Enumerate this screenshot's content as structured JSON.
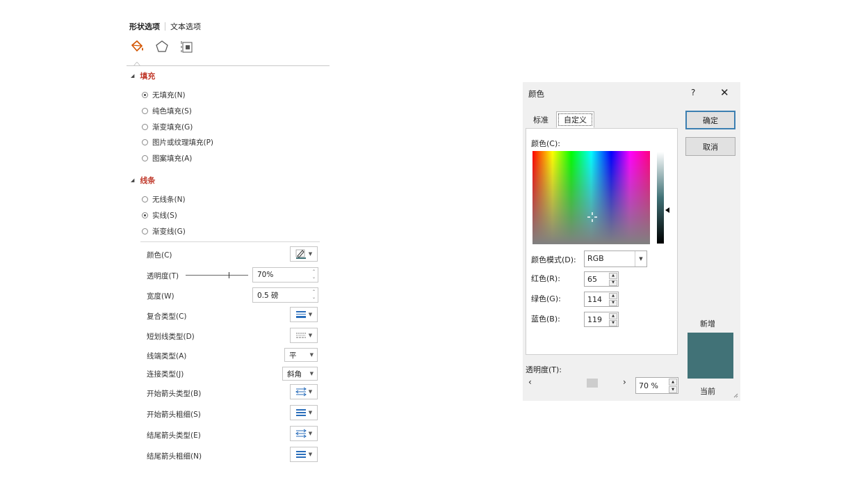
{
  "format_pane": {
    "tab_shape": "形状选项",
    "tab_text": "文本选项",
    "icons": [
      "fill-line-icon",
      "effects-pentagon-icon",
      "size-properties-icon"
    ],
    "fill": {
      "title": "填充",
      "options": [
        "无填充(N)",
        "纯色填充(S)",
        "渐变填充(G)",
        "图片或纹理填充(P)",
        "图案填充(A)"
      ],
      "selected": "无填充(N)"
    },
    "line": {
      "title": "线条",
      "options": [
        "无线条(N)",
        "实线(S)",
        "渐变线(G)"
      ],
      "selected": "实线(S)"
    },
    "props": {
      "color": "颜色(C)",
      "transparency": "透明度(T)",
      "transparency_value": "70%",
      "width": "宽度(W)",
      "width_value": "0.5 磅",
      "compound": "复合类型(C)",
      "dash": "短划线类型(D)",
      "cap": "线端类型(A)",
      "cap_value": "平",
      "join": "连接类型(J)",
      "join_value": "斜角",
      "begin_arrow_type": "开始箭头类型(B)",
      "begin_arrow_size": "开始箭头粗细(S)",
      "end_arrow_type": "结尾箭头类型(E)",
      "end_arrow_size": "结尾箭头粗细(N)"
    },
    "accent_color": "#c0392b"
  },
  "color_dialog": {
    "title": "颜色",
    "help": "?",
    "close": "✕",
    "tabs": [
      "标准",
      "自定义"
    ],
    "active_tab": "自定义",
    "colors_label": "颜色(C):",
    "mode_label": "颜色模式(D):",
    "mode_value": "RGB",
    "red_label": "红色(R):",
    "red_value": "65",
    "green_label": "绿色(G):",
    "green_value": "114",
    "blue_label": "蓝色(B):",
    "blue_value": "119",
    "ok": "确定",
    "cancel": "取消",
    "new_label": "新增",
    "current_label": "当前",
    "transparency_label": "透明度(T):",
    "transparency_value": "70 %",
    "transparency_fraction": 0.7,
    "scroll_left": "‹",
    "scroll_right": "›",
    "selected_color": "#417277"
  }
}
